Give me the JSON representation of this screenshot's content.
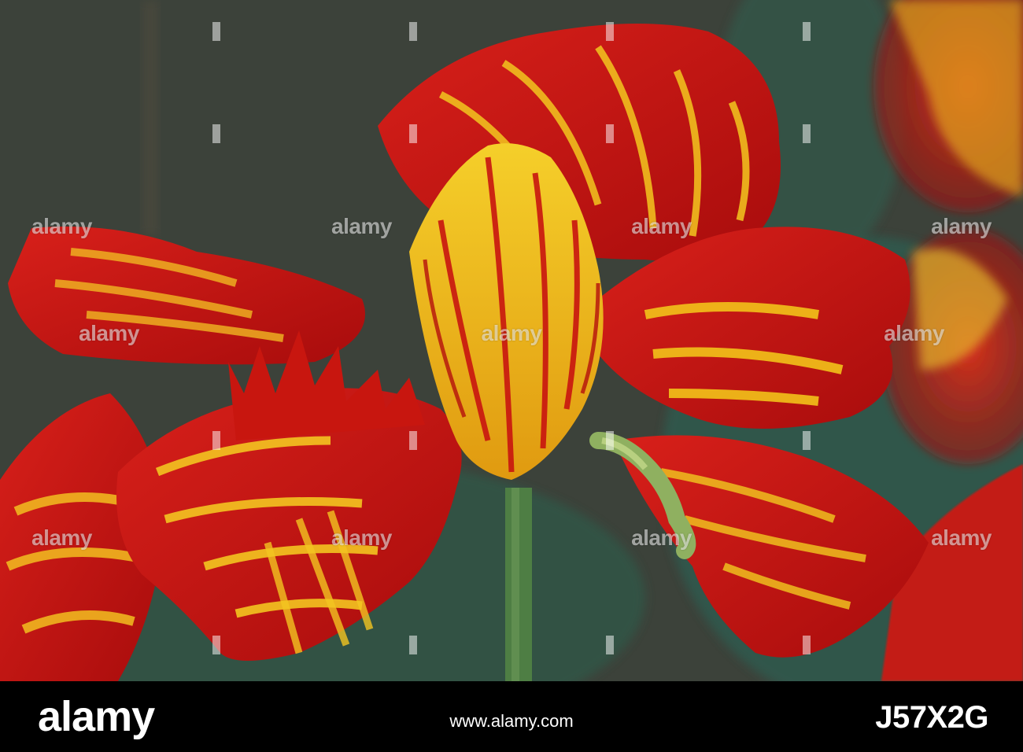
{
  "watermark": {
    "text": "alamy"
  },
  "footer": {
    "logo": "alamy",
    "image_id": "J57X2G",
    "url": "www.alamy.com"
  },
  "colors": {
    "petal_red": "#c8140f",
    "petal_yellow": "#f2c21a",
    "background_dark": "#3a4038",
    "stem_green": "#5a8a4a",
    "footer_bg": "#000000"
  }
}
